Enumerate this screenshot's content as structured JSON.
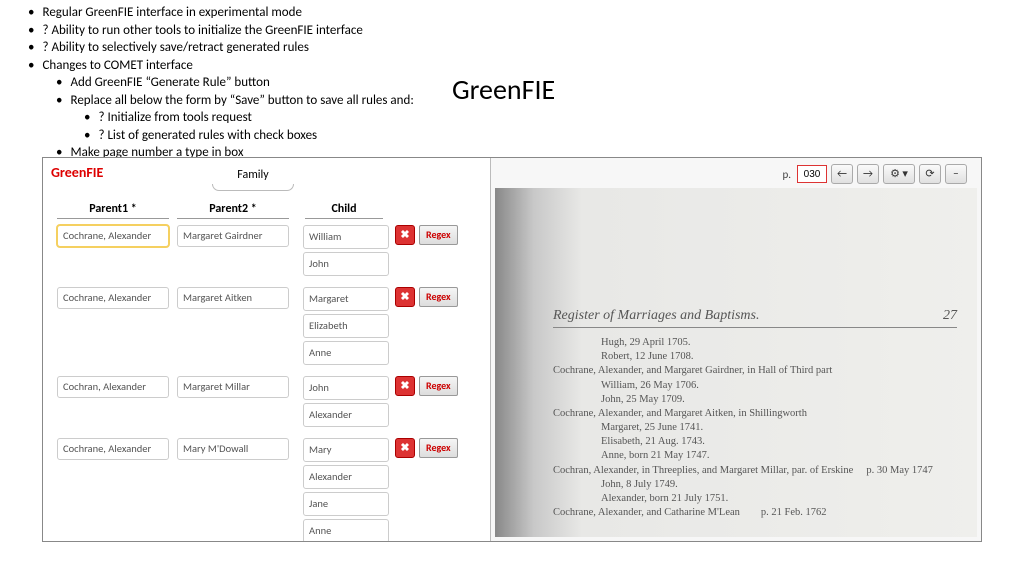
{
  "title": "GreenFIE",
  "bullets": {
    "lvl1": [
      "Regular GreenFIE interface in experimental mode",
      "? Ability to run other tools to initialize the GreenFIE interface",
      "? Ability to selectively save/retract generated rules",
      "Changes to COMET interface"
    ],
    "lvl2": [
      "Add GreenFIE “Generate Rule” button",
      "Replace all below the form by “Save” button to save all rules and:",
      "Make page number a type in box"
    ],
    "lvl3": [
      "? Initialize from tools request",
      "? List of generated rules with check boxes"
    ]
  },
  "app": {
    "name": "GreenFIE",
    "family_tab": "Family",
    "headers": {
      "p1": "Parent1 *",
      "p2": "Parent2 *",
      "ch": "Child"
    },
    "page_label": "p.",
    "page_value": "030",
    "regex_label": "Regex",
    "close_label": "✖"
  },
  "toolbar": {
    "prev": "←",
    "next": "→",
    "zoom": "⚙ ▾",
    "reset": "⟳",
    "minus": "−"
  },
  "families": [
    {
      "p1": "Cochrane, Alexander",
      "p2": "Margaret Gairdner",
      "children": [
        "William",
        "John"
      ]
    },
    {
      "p1": "Cochrane, Alexander",
      "p2": "Margaret Aitken",
      "children": [
        "Margaret",
        "Elizabeth",
        "Anne"
      ]
    },
    {
      "p1": "Cochran, Alexander",
      "p2": "Margaret Millar",
      "children": [
        "John",
        "Alexander"
      ]
    },
    {
      "p1": "Cochrane, Alexander",
      "p2": "Mary M'Dowall",
      "children": [
        "Mary",
        "Alexander",
        "Jane",
        "Anne"
      ]
    }
  ],
  "doc": {
    "heading": "Register of Marriages and Baptisms.",
    "pageno": "27",
    "lines": [
      "Hugh, 29 April 1705.",
      "Robert, 12 June 1708.",
      "Cochrane, Alexander, and Margaret Gairdner, in Hall of Third part",
      "William, 26 May 1706.",
      "John, 25 May 1709.",
      "Cochrane, Alexander, and Margaret Aitken, in Shillingworth",
      "Margaret, 25 June 1741.",
      "Elisabeth, 21 Aug. 1743.",
      "Anne, born 21 May 1747.",
      "Cochran, Alexander, in Threeplies, and Margaret Millar, par. of Erskine     p. 30 May 1747",
      "John, 8 July 1749.",
      "Alexander, born 21 July 1751.",
      "Cochrane, Alexander, and Catharine M'Lean        p. 21 Feb. 1762"
    ],
    "subIdx": [
      0,
      1,
      3,
      4,
      6,
      7,
      8,
      10,
      11
    ]
  }
}
